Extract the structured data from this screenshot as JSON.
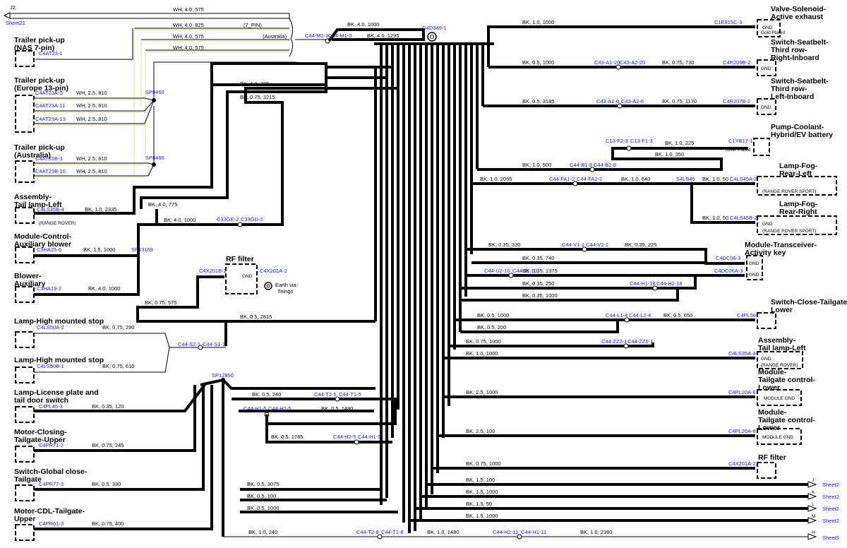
{
  "page": {
    "label": "J2",
    "sheet_in": "Sheet21"
  },
  "top_wires": [
    {
      "spec": "WH, 4.0, 575"
    },
    {
      "spec": "WH, 4.0, 825",
      "note": "(7_PIN)"
    },
    {
      "spec": "WH, 4.0, 575",
      "note": "(Australia)"
    },
    {
      "spec": "WH, 4.0, 575"
    }
  ],
  "left_components": [
    {
      "title": [
        "Trailer pick-up",
        "(NAS 7-pin)"
      ],
      "connectors": [
        "C4AT23-1"
      ]
    },
    {
      "title": [
        "Trailer pick-up",
        "(Europe 13-pin)"
      ],
      "connectors": [
        "C4AT23A-3",
        "C4AT23A-11",
        "C4AT23A-13"
      ],
      "wires": [
        "WH, 2.5, 810",
        "WH, 2.5, 810",
        "WH, 2.5, 810"
      ],
      "splice": "SP8460"
    },
    {
      "title": [
        "Trailer pick-up",
        "(Australia)"
      ],
      "connectors": [
        "C4AT23B-3",
        "C4AT23B-10"
      ],
      "wires": [
        "WH, 2.5, 810",
        "WH, 2.5, 810"
      ],
      "splice": "SP8460"
    },
    {
      "title": [
        "Assembly-",
        "Tail lamp-Left"
      ],
      "connectors": [
        "C4LS35B-4"
      ],
      "wires": [
        "BK, 1.0, 2335"
      ],
      "note": "(RANGE ROVER)"
    },
    {
      "title": [
        "Module-Control-",
        "Auxiliary blower"
      ],
      "connectors": [
        "C3HA25-6"
      ],
      "wires": [
        "BK, 1.5, 1000"
      ],
      "splice": "SP13169"
    },
    {
      "title": [
        "Blower-",
        "Auxiliary"
      ],
      "connectors": [
        "C3HA19-2"
      ],
      "wires": [
        "BK, 4.0, 1000"
      ]
    },
    {
      "title": [
        "Lamp-High mounted stop"
      ],
      "connectors": [
        "C4LS50A-2"
      ],
      "wires": [
        "BK, 0.75, 290"
      ]
    },
    {
      "title": [
        "Lamp-High mounted stop"
      ],
      "connectors": [
        "C4LS50B-1"
      ],
      "wires": [
        "BK, 0.75, 610"
      ]
    },
    {
      "title": [
        "Lamp-License plate and",
        "tail door switch"
      ],
      "connectors": [
        "C4PL45-3"
      ],
      "wires": [
        "BK, 0.35, 120"
      ]
    },
    {
      "title": [
        "Motor-Closing-",
        "Tailgate-Upper"
      ],
      "connectors": [
        "C4PR71-2"
      ],
      "wires": [
        "BK, 0.75, 245"
      ]
    },
    {
      "title": [
        "Switch-Global close-",
        "Tailgate"
      ],
      "connectors": [
        "C4PR77-3"
      ],
      "wires": [
        "BK, 0.5, 330"
      ]
    },
    {
      "title": [
        "Motor-CDL-Tailgate-",
        "Upper"
      ],
      "connectors": [
        "C4PR61-3"
      ],
      "wires": [
        "BK, 0.75, 400"
      ]
    }
  ],
  "right_components": [
    {
      "title": [
        "Valve-Solenoid-",
        "Active exhaust"
      ],
      "connector": "C1E915C-3",
      "wire": "BK, 1.0, 1000",
      "gnd": "GND",
      "sub": "Gold Plated"
    },
    {
      "title": [
        "Switch-Seatbelt-",
        "Third row-",
        "Right-Inboard"
      ],
      "connector": "C4R209B-2",
      "inline": [
        "C43-A1-20",
        "C43-A2-20"
      ],
      "wires": [
        "BK, 0.5, 1000",
        "BK, 0.75, 730"
      ],
      "gnd": "GND"
    },
    {
      "title": [
        "Switch-Seatbelt-",
        "Third row-",
        "Left-Inboard"
      ],
      "connector": "C4R207B-2",
      "inline": [
        "C43-A1-6",
        "C43-A2-6"
      ],
      "wires": [
        "BK, 0.5, 3185",
        "BK, 0.75, 1170"
      ],
      "gnd": "GND"
    },
    {
      "title": [
        "Pump-Coolant-",
        "Hybrid/EV battery"
      ],
      "connector": "C1YB17-1",
      "inline": [
        "C13-F2-3",
        "C13-F1-3"
      ],
      "wires": [
        "BK, 1.0, 225",
        "BK, 1.0, 350"
      ],
      "sub": "Silver Plated"
    },
    {
      "title": [
        "Lamp-Fog-",
        "Rear-Left"
      ],
      "connector": "C4LS45A-2",
      "inline": [
        "C44-FA1-2",
        "C44-FA2-2"
      ],
      "wires": [
        "BK, 1.0, 2055",
        "BK, 1.0, 640",
        "BK, 1.0, 50"
      ],
      "splice": "S4LS45",
      "note": "(RANGE ROVER SPORT)"
    },
    {
      "title": [
        "Lamp-Fog-",
        "Rear-Right"
      ],
      "connector": "C4LS45B-2",
      "wire": "BK, 1.0, 50",
      "gnd": "GND",
      "note": "(RANGE ROVER SPORT)"
    },
    {
      "title": [
        "Module-Transceiver-",
        "Activity key"
      ],
      "connectors": [
        "C4DC06-3",
        "C4DC06A-3"
      ],
      "inline": [
        "C44-V1-1",
        "C44-V2-1",
        "C44-U2-10",
        "C44-J1-10",
        "C44-H1-18",
        "C44-H2-18"
      ],
      "wires": [
        "BK, 0.35, 330",
        "BK, 0.35, 225",
        "BK, 0.35, 740",
        "BK, 0.35, 1375",
        "BK, 0.35, 250",
        "BK, 0.35, 1000"
      ],
      "gnd": "GND"
    },
    {
      "title": [
        "Switch-Close-Tailgate-",
        "Lower"
      ],
      "connector": "C4PL56-3",
      "inline": [
        "C44-L1-4",
        "C44-L2-4"
      ],
      "wires": [
        "BK, 0.5, 1000",
        "BK, 0.5, 650",
        "BK, 0.5, 200"
      ]
    },
    {
      "title": [
        "Assembly-",
        "Tail lamp-Left"
      ],
      "connector": "C4LS35A-4",
      "inline": [
        "C44-ZZ2-1",
        "C44-ZZ1-1"
      ],
      "wires": [
        "BK, 0.75, 1000",
        "BK, 1.0, 1000"
      ],
      "gnd": "GND",
      "note": "(RANGE ROVER)"
    },
    {
      "title": [
        "Module-",
        "Tailgate control-",
        "Lower"
      ],
      "connector": "C4PL20A-8",
      "wire": "BK, 2.5, 1000",
      "gnd": "MODULE GND"
    },
    {
      "title": [
        "Module-",
        "Tailgate control-",
        "Lower"
      ],
      "connector": "C4PL20A-8",
      "wire": "BK, 2.5, 100",
      "gnd": "MODULE GND"
    },
    {
      "title": [
        "RF filter"
      ],
      "connector": "C4X201A-2",
      "wire": "BK, 0.75, 1000"
    }
  ],
  "center": {
    "ground": "G4D349-1",
    "inline_top": [
      "C44-M2-3",
      "C44-M1-3"
    ],
    "top_wires": [
      "BK, 4.0, 1000",
      "BK, 4.0, 1295"
    ],
    "bus_wires": [
      "BK, 4.0, 775",
      "BK, 0.75, 3215",
      "BK, 4.0, 775",
      "BK, 4.0, 1000",
      "BK, 0.75, 575",
      "BK, 0.5, 2815",
      "BK, 1.0, 500"
    ],
    "inline_b": [
      "C44-B1-8",
      "C44-B2-8"
    ],
    "inline_33": [
      "C33GE-2",
      "C33GD-2"
    ],
    "rf_filter": {
      "title": "RF filter",
      "connectors": [
        "C4X201B-2",
        "C4X201A-2"
      ],
      "gnd": "GND",
      "earth": [
        "Earth via-",
        "fixings"
      ]
    },
    "hms_inline": [
      "C44-S2-1",
      "C44-S1-1"
    ],
    "splice_lower": "SP12850",
    "lower_inline": [
      {
        "pair": [
          "C44-T2-5",
          "C44-T1-5"
        ],
        "wire": "BK, 0.5, 240"
      },
      {
        "pair": [
          "C44-H1-5",
          "C44-H2-5"
        ],
        "wire": "BK, 0.5, 1480"
      },
      {
        "pair": [
          "C44-H2-5",
          "C44-H1-5"
        ],
        "wire": "BK, 0.5, 1785"
      }
    ],
    "lower_wires": [
      "BK, 0.5, 3075",
      "BK, 0.5, 100",
      "BK, 0.5, 1000"
    ]
  },
  "sheet_outputs": [
    {
      "wire": "BK, 1.5, 100",
      "letter": "J",
      "sheet": "Sheet2"
    },
    {
      "wire": "BK, 1.5, 1000",
      "letter": "K",
      "sheet": "Sheet2"
    },
    {
      "wire": "BK, 1.5, 50",
      "letter": "L",
      "sheet": "Sheet2"
    },
    {
      "wire": "BK, 1.5, 1000",
      "letter": "M",
      "sheet": "Sheet2"
    }
  ],
  "bottom": {
    "wires": [
      "BK, 1.0, 240",
      "BK, 1.0, 1480",
      "BK, 1.0, 2360"
    ],
    "inline": [
      "C44-T2-8",
      "C44-T1-8",
      "C44-H2-11",
      "C44-H1-11"
    ],
    "letter": "H",
    "sheet": "Sheet5"
  }
}
